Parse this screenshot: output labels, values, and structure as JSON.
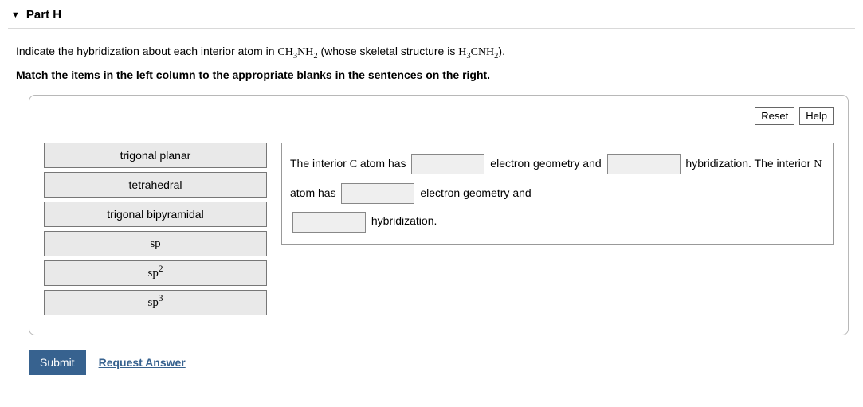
{
  "header": {
    "title": "Part H"
  },
  "instructions": {
    "line1_pre": "Indicate the hybridization about each interior atom in ",
    "formula1": "CH3NH2",
    "line1_mid": " (whose skeletal structure is ",
    "formula2": "H3CNH2",
    "line1_post": ").",
    "line2": "Match the items in the left column to the appropriate blanks in the sentences on the right."
  },
  "buttons": {
    "reset": "Reset",
    "help": "Help",
    "submit": "Submit",
    "request": "Request Answer"
  },
  "drag_items": {
    "i0": "trigonal planar",
    "i1": "tetrahedral",
    "i2": "trigonal bipyramidal",
    "i3": "sp",
    "i4": "sp2",
    "i5": "sp3"
  },
  "sentence": {
    "s1": "The interior ",
    "atom1": "C",
    "s2": " atom has ",
    "s3": " electron geometry and ",
    "s4": " hybridization. The interior ",
    "atom2": "N",
    "s5": " atom has ",
    "s6": " electron geometry and ",
    "s7": " hybridization."
  }
}
